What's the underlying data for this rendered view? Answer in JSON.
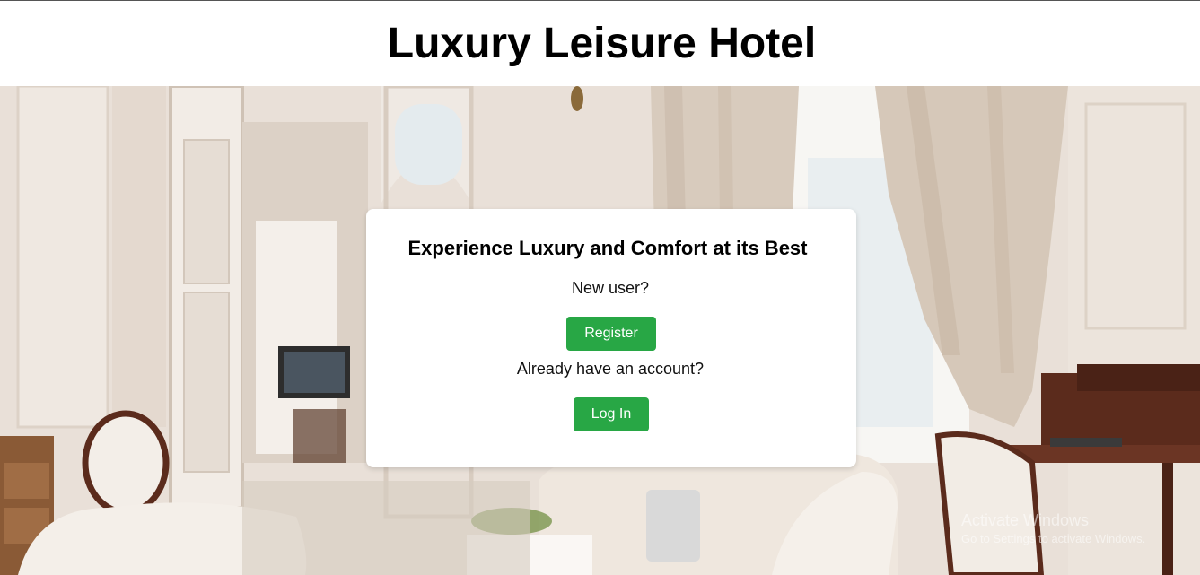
{
  "header": {
    "title": "Luxury Leisure Hotel"
  },
  "card": {
    "heading": "Experience Luxury and Comfort at its Best",
    "new_user_prompt": "New user?",
    "register_label": "Register",
    "existing_user_prompt": "Already have an account?",
    "login_label": "Log In"
  },
  "watermark": {
    "title": "Activate Windows",
    "subtitle": "Go to Settings to activate Windows."
  },
  "colors": {
    "button": "#28a745",
    "card": "#ffffff"
  }
}
